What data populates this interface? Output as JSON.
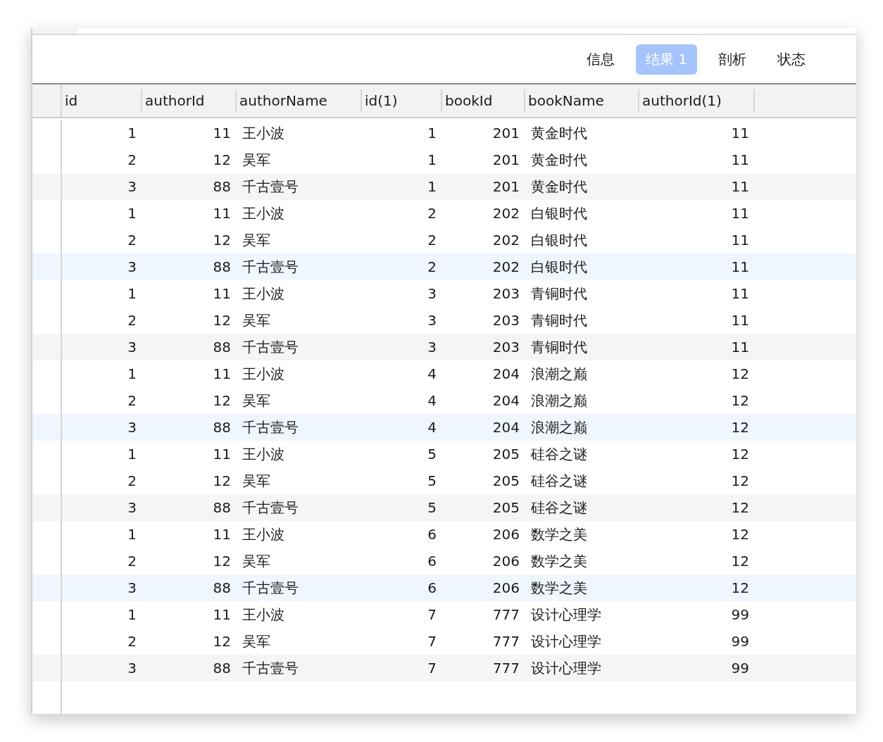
{
  "tabs": [
    {
      "label": "信息",
      "selected": false
    },
    {
      "label": "结果 1",
      "selected": true
    },
    {
      "label": "剖析",
      "selected": false
    },
    {
      "label": "状态",
      "selected": false
    }
  ],
  "table": {
    "columns": [
      {
        "label": "id",
        "kind": "number"
      },
      {
        "label": "authorId",
        "kind": "number"
      },
      {
        "label": "authorName",
        "kind": "text"
      },
      {
        "label": "id(1)",
        "kind": "number"
      },
      {
        "label": "bookId",
        "kind": "number"
      },
      {
        "label": "bookName",
        "kind": "text"
      },
      {
        "label": "authorId(1)",
        "kind": "number"
      }
    ],
    "rows": [
      [
        "1",
        "11",
        "王小波",
        "1",
        "201",
        "黄金时代",
        "11"
      ],
      [
        "2",
        "12",
        "吴军",
        "1",
        "201",
        "黄金时代",
        "11"
      ],
      [
        "3",
        "88",
        "千古壹号",
        "1",
        "201",
        "黄金时代",
        "11"
      ],
      [
        "1",
        "11",
        "王小波",
        "2",
        "202",
        "白银时代",
        "11"
      ],
      [
        "2",
        "12",
        "吴军",
        "2",
        "202",
        "白银时代",
        "11"
      ],
      [
        "3",
        "88",
        "千古壹号",
        "2",
        "202",
        "白银时代",
        "11"
      ],
      [
        "1",
        "11",
        "王小波",
        "3",
        "203",
        "青铜时代",
        "11"
      ],
      [
        "2",
        "12",
        "吴军",
        "3",
        "203",
        "青铜时代",
        "11"
      ],
      [
        "3",
        "88",
        "千古壹号",
        "3",
        "203",
        "青铜时代",
        "11"
      ],
      [
        "1",
        "11",
        "王小波",
        "4",
        "204",
        "浪潮之巅",
        "12"
      ],
      [
        "2",
        "12",
        "吴军",
        "4",
        "204",
        "浪潮之巅",
        "12"
      ],
      [
        "3",
        "88",
        "千古壹号",
        "4",
        "204",
        "浪潮之巅",
        "12"
      ],
      [
        "1",
        "11",
        "王小波",
        "5",
        "205",
        "硅谷之谜",
        "12"
      ],
      [
        "2",
        "12",
        "吴军",
        "5",
        "205",
        "硅谷之谜",
        "12"
      ],
      [
        "3",
        "88",
        "千古壹号",
        "5",
        "205",
        "硅谷之谜",
        "12"
      ],
      [
        "1",
        "11",
        "王小波",
        "6",
        "206",
        "数学之美",
        "12"
      ],
      [
        "2",
        "12",
        "吴军",
        "6",
        "206",
        "数学之美",
        "12"
      ],
      [
        "3",
        "88",
        "千古壹号",
        "6",
        "206",
        "数学之美",
        "12"
      ],
      [
        "1",
        "11",
        "王小波",
        "7",
        "777",
        "设计心理学",
        "99"
      ],
      [
        "2",
        "12",
        "吴军",
        "7",
        "777",
        "设计心理学",
        "99"
      ],
      [
        "3",
        "88",
        "千古壹号",
        "7",
        "777",
        "设计心理学",
        "99"
      ]
    ]
  }
}
